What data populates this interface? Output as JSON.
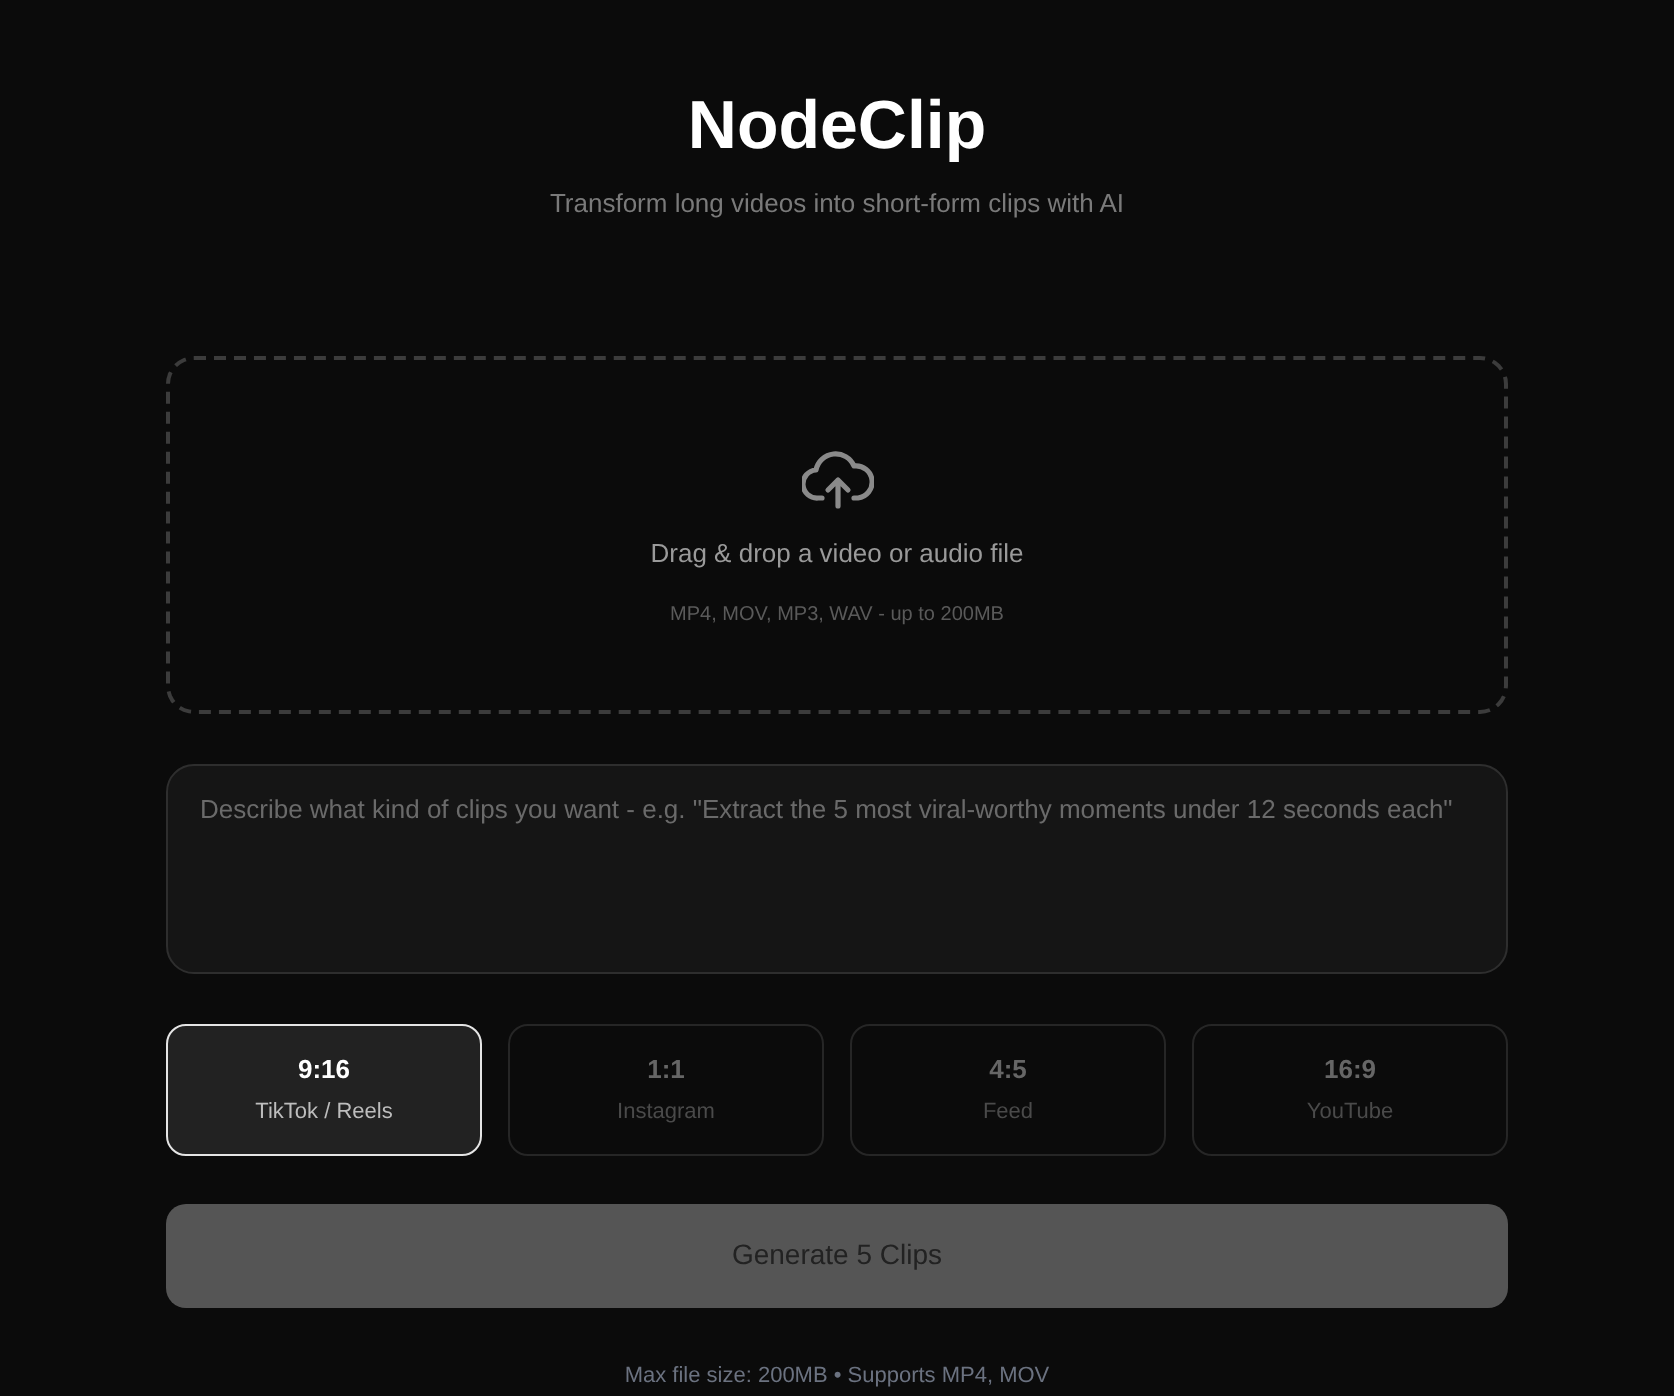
{
  "header": {
    "title": "NodeClip",
    "subtitle": "Transform long videos into short-form clips with AI"
  },
  "dropzone": {
    "title": "Drag & drop a video or audio file",
    "hint": "MP4, MOV, MP3, WAV - up to 200MB"
  },
  "prompt": {
    "placeholder": "Describe what kind of clips you want - e.g. \"Extract the 5 most viral-worthy moments under 12 seconds each\""
  },
  "formats": [
    {
      "ratio": "9:16",
      "label": "TikTok / Reels",
      "selected": true
    },
    {
      "ratio": "1:1",
      "label": "Instagram",
      "selected": false
    },
    {
      "ratio": "4:5",
      "label": "Feed",
      "selected": false
    },
    {
      "ratio": "16:9",
      "label": "YouTube",
      "selected": false
    }
  ],
  "generate_button": {
    "label": "Generate 5 Clips",
    "disabled": true
  },
  "footer": "Max file size: 200MB • Supports MP4, MOV"
}
